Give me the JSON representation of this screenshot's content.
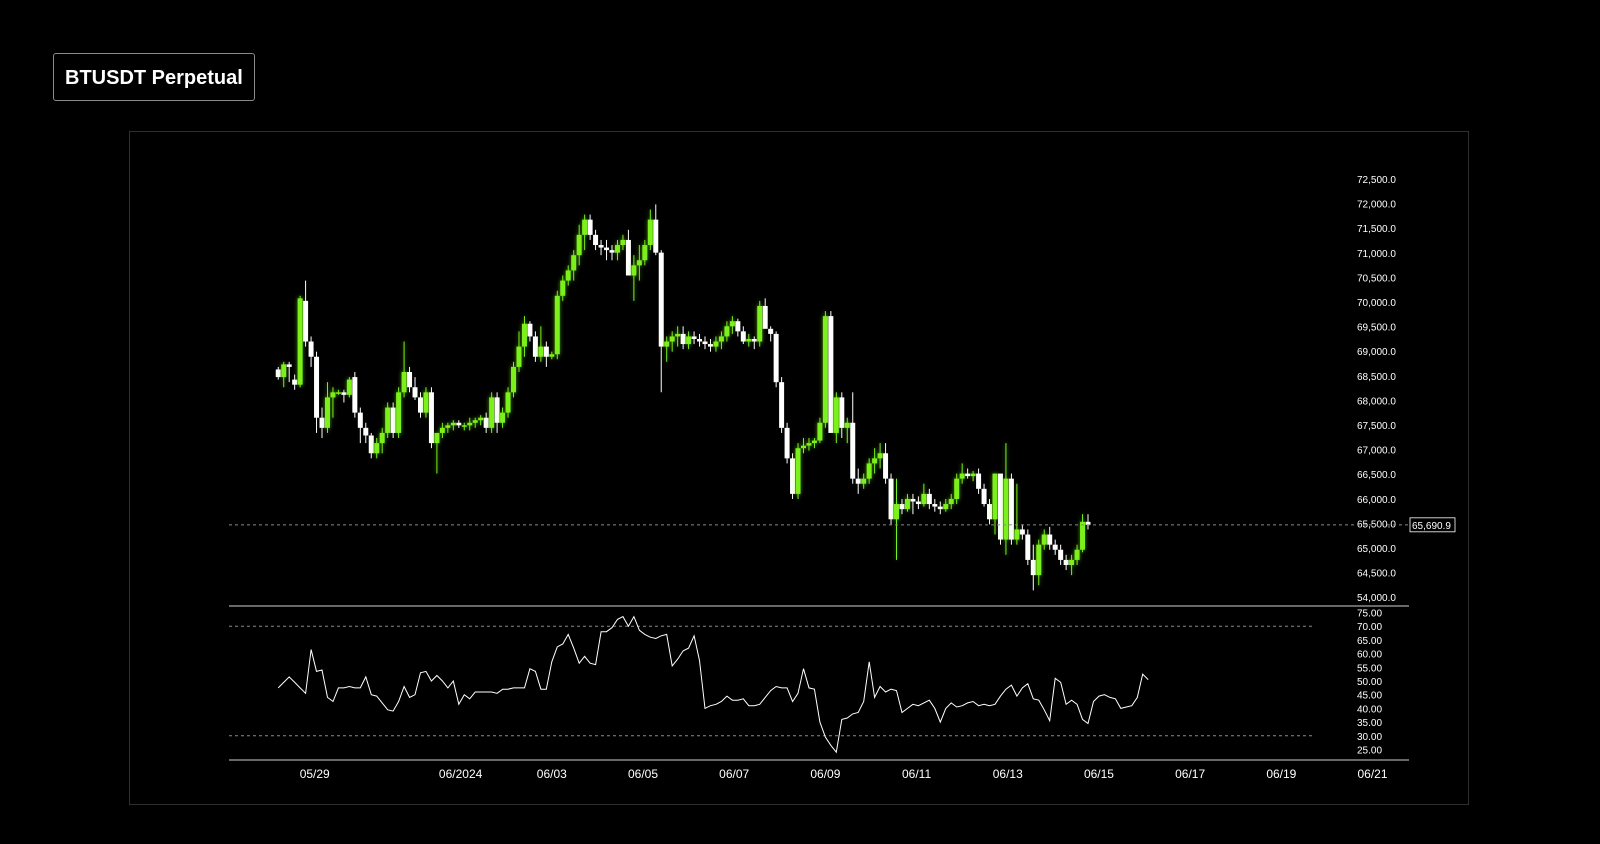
{
  "header": {
    "title": "BTUSDT Perpetual"
  },
  "colors": {
    "background": "#000000",
    "bull_candle": "#7cf01a",
    "bear_candle": "#ffffff",
    "text": "#ffffff",
    "grid_dashed": "#8a8a8a",
    "frame": "#2e2e2e"
  },
  "chart_data": [
    {
      "type": "candlestick",
      "title": "BTUSDT Perpetual",
      "price_axis_ticks": [
        "72,500.0",
        "72,000.0",
        "71,500.0",
        "71,000.0",
        "70,500.0",
        "70,000.0",
        "69,500.0",
        "69,000.0",
        "68,500.0",
        "68,000.0",
        "67,500.0",
        "67,000.0",
        "66,500.0",
        "66,000.0",
        "65,500.0",
        "65,000.0",
        "64,500.0",
        "54,000.0"
      ],
      "ylim": [
        64250,
        72500
      ],
      "x_ticks": [
        "05/29",
        "06/2024",
        "06/03",
        "06/05",
        "06/07",
        "06/09",
        "06/11",
        "06/13",
        "06/15",
        "06/17",
        "06/19",
        "06/21"
      ],
      "x_tick_positions": [
        2,
        10,
        15,
        20,
        25,
        30,
        35,
        40,
        45,
        50,
        55,
        60
      ],
      "x_range": [
        -2.7,
        62.0
      ],
      "candle_step": 0.3,
      "last_price": 65690.9,
      "last_price_label": "65,690.9",
      "candles": [
        [
          68750,
          68800,
          68550,
          68600
        ],
        [
          68600,
          68900,
          68400,
          68850
        ],
        [
          68850,
          68900,
          68500,
          68800
        ],
        [
          68550,
          68650,
          68350,
          68450
        ],
        [
          68450,
          70200,
          68400,
          70150
        ],
        [
          70100,
          70500,
          69200,
          69300
        ],
        [
          69300,
          69400,
          68800,
          69000
        ],
        [
          69000,
          69100,
          67500,
          67800
        ],
        [
          67800,
          68000,
          67400,
          67600
        ],
        [
          67600,
          68500,
          67500,
          68200
        ],
        [
          68200,
          68400,
          67800,
          68300
        ],
        [
          68300,
          68350,
          68250,
          68300
        ],
        [
          68300,
          68350,
          68100,
          68250
        ],
        [
          68250,
          68600,
          68200,
          68550
        ],
        [
          68600,
          68700,
          67800,
          67900
        ],
        [
          67900,
          68000,
          67300,
          67600
        ],
        [
          67600,
          67700,
          67300,
          67450
        ],
        [
          67450,
          67500,
          67000,
          67100
        ],
        [
          67100,
          67400,
          67000,
          67300
        ],
        [
          67300,
          67600,
          67100,
          67500
        ],
        [
          67500,
          68100,
          67400,
          68000
        ],
        [
          68000,
          68100,
          67400,
          67500
        ],
        [
          67500,
          68400,
          67400,
          68300
        ],
        [
          68300,
          69300,
          68200,
          68700
        ],
        [
          68700,
          68800,
          68300,
          68400
        ],
        [
          68400,
          68600,
          68150,
          68200
        ],
        [
          68200,
          68300,
          67800,
          67900
        ],
        [
          67900,
          68400,
          67800,
          68300
        ],
        [
          68300,
          68400,
          67200,
          67300
        ],
        [
          67300,
          67500,
          66700,
          67500
        ],
        [
          67500,
          67700,
          67400,
          67600
        ],
        [
          67600,
          67700,
          67500,
          67650
        ],
        [
          67650,
          67750,
          67550,
          67700
        ],
        [
          67700,
          67750,
          67600,
          67650
        ],
        [
          67650,
          67700,
          67550,
          67650
        ],
        [
          67650,
          67800,
          67550,
          67700
        ],
        [
          67700,
          67800,
          67600,
          67750
        ],
        [
          67750,
          67850,
          67650,
          67800
        ],
        [
          67800,
          67900,
          67500,
          67600
        ],
        [
          67600,
          68300,
          67500,
          68200
        ],
        [
          68200,
          68300,
          67500,
          67700
        ],
        [
          67700,
          68000,
          67600,
          67900
        ],
        [
          67900,
          68400,
          67800,
          68300
        ],
        [
          68300,
          68900,
          68200,
          68800
        ],
        [
          68800,
          69500,
          68700,
          69200
        ],
        [
          69200,
          69800,
          69000,
          69650
        ],
        [
          69650,
          69700,
          69300,
          69400
        ],
        [
          69400,
          69500,
          68900,
          69000
        ],
        [
          69000,
          69600,
          68900,
          69200
        ],
        [
          69200,
          69300,
          68800,
          69000
        ],
        [
          69000,
          69100,
          68950,
          69050
        ],
        [
          69050,
          70300,
          68950,
          70200
        ],
        [
          70200,
          70600,
          70100,
          70500
        ],
        [
          70500,
          70800,
          70400,
          70700
        ],
        [
          70700,
          71100,
          70500,
          71000
        ],
        [
          71000,
          71600,
          70800,
          71400
        ],
        [
          71400,
          71800,
          71100,
          71700
        ],
        [
          71700,
          71800,
          71300,
          71400
        ],
        [
          71400,
          71500,
          71100,
          71200
        ],
        [
          71200,
          71300,
          71000,
          71150
        ],
        [
          71150,
          71300,
          70900,
          71100
        ],
        [
          71100,
          71200,
          70900,
          71050
        ],
        [
          71050,
          71300,
          70900,
          71200
        ],
        [
          71200,
          71400,
          71100,
          71300
        ],
        [
          71300,
          71500,
          70700,
          70600
        ],
        [
          70600,
          71000,
          70100,
          70800
        ],
        [
          70800,
          71200,
          70500,
          70900
        ],
        [
          70900,
          71300,
          70800,
          71200
        ],
        [
          71200,
          71900,
          71100,
          71700
        ],
        [
          71700,
          72000,
          71000,
          71050
        ],
        [
          71050,
          71100,
          68300,
          69200
        ],
        [
          69200,
          69400,
          68900,
          69300
        ],
        [
          69300,
          69500,
          69100,
          69400
        ],
        [
          69400,
          69600,
          69200,
          69450
        ],
        [
          69450,
          69600,
          69150,
          69250
        ],
        [
          69250,
          69500,
          69150,
          69400
        ],
        [
          69400,
          69500,
          69250,
          69350
        ],
        [
          69350,
          69450,
          69200,
          69300
        ],
        [
          69300,
          69400,
          69150,
          69250
        ],
        [
          69250,
          69350,
          69100,
          69200
        ],
        [
          69200,
          69400,
          69100,
          69300
        ],
        [
          69300,
          69500,
          69150,
          69400
        ],
        [
          69400,
          69700,
          69300,
          69600
        ],
        [
          69600,
          69800,
          69450,
          69700
        ],
        [
          69700,
          69750,
          69400,
          69500
        ],
        [
          69500,
          69600,
          69250,
          69300
        ],
        [
          69300,
          69450,
          69200,
          69350
        ],
        [
          69350,
          69400,
          69150,
          69300
        ],
        [
          69300,
          70100,
          69200,
          70000
        ],
        [
          70000,
          70150,
          69800,
          69550
        ],
        [
          69550,
          69600,
          69300,
          69450
        ],
        [
          69450,
          69500,
          68400,
          68500
        ],
        [
          68500,
          68600,
          67500,
          67600
        ],
        [
          67600,
          67700,
          66900,
          67000
        ],
        [
          67000,
          67100,
          66200,
          66300
        ],
        [
          66300,
          67300,
          66200,
          67200
        ],
        [
          67200,
          67400,
          67100,
          67250
        ],
        [
          67250,
          67400,
          67150,
          67300
        ],
        [
          67300,
          67400,
          67200,
          67350
        ],
        [
          67350,
          67800,
          67300,
          67700
        ],
        [
          67700,
          69900,
          67600,
          69800
        ],
        [
          69800,
          69900,
          68000,
          67500
        ],
        [
          67500,
          68300,
          67300,
          68200
        ],
        [
          68200,
          68300,
          67400,
          67600
        ],
        [
          67600,
          67800,
          67300,
          67700
        ],
        [
          67700,
          68300,
          66500,
          66600
        ],
        [
          66600,
          66800,
          66300,
          66500
        ],
        [
          66500,
          66700,
          66400,
          66600
        ],
        [
          66600,
          67000,
          66500,
          66900
        ],
        [
          66900,
          67200,
          66700,
          67000
        ],
        [
          67000,
          67300,
          66800,
          67100
        ],
        [
          67100,
          67300,
          66500,
          66600
        ],
        [
          66600,
          66700,
          65700,
          65800
        ],
        [
          65800,
          66600,
          65000,
          66100
        ],
        [
          66100,
          66200,
          65900,
          66000
        ],
        [
          66000,
          66300,
          65950,
          66200
        ],
        [
          66200,
          66300,
          65900,
          66150
        ],
        [
          66150,
          66250,
          66000,
          66100
        ],
        [
          66100,
          66500,
          66050,
          66300
        ],
        [
          66300,
          66400,
          66000,
          66100
        ],
        [
          66100,
          66200,
          65950,
          66050
        ],
        [
          66050,
          66150,
          65900,
          66000
        ],
        [
          66000,
          66200,
          65950,
          66100
        ],
        [
          66100,
          66300,
          66000,
          66200
        ],
        [
          66200,
          66700,
          66100,
          66600
        ],
        [
          66600,
          66900,
          66500,
          66700
        ],
        [
          66700,
          66800,
          66600,
          66650
        ],
        [
          66650,
          66750,
          66550,
          66700
        ],
        [
          66700,
          66800,
          66300,
          66400
        ],
        [
          66400,
          66500,
          66050,
          66100
        ],
        [
          66100,
          66200,
          65700,
          65800
        ],
        [
          65800,
          66700,
          65500,
          66700
        ],
        [
          66700,
          66700,
          65300,
          65400
        ],
        [
          65400,
          67300,
          65100,
          66600
        ],
        [
          66600,
          66700,
          65300,
          65400
        ],
        [
          65400,
          66500,
          65300,
          65600
        ],
        [
          65600,
          65700,
          65400,
          65500
        ],
        [
          65500,
          65600,
          64900,
          65000
        ],
        [
          65000,
          65300,
          64400,
          64700
        ],
        [
          64700,
          65400,
          64500,
          65300
        ],
        [
          65300,
          65600,
          65200,
          65500
        ],
        [
          65500,
          65650,
          65200,
          65300
        ],
        [
          65300,
          65400,
          65100,
          65200
        ],
        [
          65200,
          65300,
          64900,
          65000
        ],
        [
          65000,
          65100,
          64800,
          64900
        ],
        [
          64900,
          65100,
          64700,
          65000
        ],
        [
          65000,
          65300,
          64900,
          65200
        ],
        [
          65200,
          65900,
          65150,
          65750
        ],
        [
          65750,
          65900,
          65600,
          65690.9
        ]
      ]
    },
    {
      "type": "line",
      "axis_ticks": [
        "75.00",
        "70.00",
        "65.00",
        "60.00",
        "55.00",
        "50.00",
        "45.00",
        "40.00",
        "35.00",
        "30.00",
        "25.00"
      ],
      "ylim": [
        25,
        75
      ],
      "reference_lines": [
        70,
        30
      ],
      "series": [
        {
          "values": [
            47.5,
            49.5,
            51.5,
            49.5,
            47.5,
            45.5,
            61.5,
            53.5,
            54.0,
            44.0,
            42.5,
            47.5,
            47.5,
            48.0,
            47.5,
            47.5,
            51.5,
            45.0,
            44.5,
            42.0,
            39.5,
            39.0,
            42.5,
            48.0,
            44.0,
            45.0,
            53.0,
            53.5,
            50.0,
            52.0,
            50.0,
            47.5,
            50.0,
            41.5,
            45.0,
            43.5,
            46.0,
            46.0,
            46.0,
            46.0,
            45.5,
            47.0,
            47.0,
            47.5,
            47.5,
            47.5,
            54.5,
            53.5,
            47.0,
            47.0,
            57.0,
            62.5,
            63.5,
            67.0,
            62.0,
            56.5,
            59.0,
            56.5,
            56.0,
            68.0,
            68.0,
            69.5,
            72.5,
            73.5,
            70.0,
            73.5,
            68.5,
            67.0,
            66.0,
            65.5,
            66.5,
            67.0,
            55.5,
            58.0,
            61.0,
            62.0,
            66.5,
            57.5,
            40.0,
            41.0,
            41.5,
            42.5,
            44.5,
            43.0,
            43.0,
            43.5,
            41.0,
            41.0,
            41.5,
            44.0,
            46.5,
            48.0,
            47.5,
            47.5,
            42.5,
            45.5,
            54.5,
            47.5,
            47.0,
            35.0,
            29.5,
            26.5,
            24.0,
            36.0,
            36.5,
            38.0,
            38.5,
            42.5,
            57.0,
            44.0,
            48.0,
            46.0,
            47.0,
            46.5,
            38.5,
            40.0,
            41.5,
            41.0,
            42.0,
            43.0,
            40.0,
            35.0,
            40.0,
            42.0,
            40.5,
            41.0,
            42.0,
            42.5,
            41.0,
            41.5,
            41.0,
            41.5,
            44.5,
            47.0,
            48.5,
            44.5,
            47.5,
            49.0,
            43.5,
            43.0,
            39.5,
            35.5,
            51.0,
            49.5,
            41.5,
            43.0,
            41.5,
            36.0,
            34.5,
            42.5,
            44.5,
            45.0,
            44.0,
            43.5,
            40.0,
            40.5,
            41.0,
            44.0,
            52.5,
            50.5
          ]
        }
      ]
    }
  ]
}
